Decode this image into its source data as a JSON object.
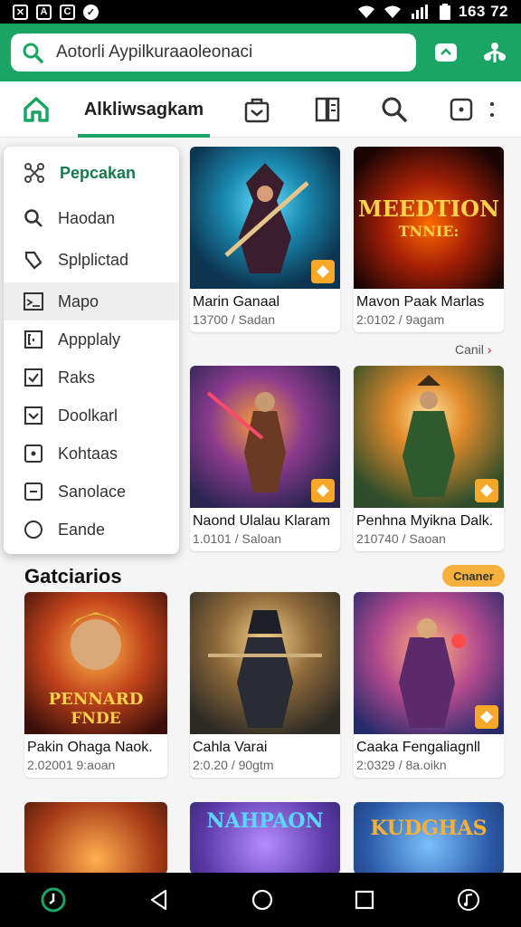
{
  "status_bar": {
    "time": "163 72"
  },
  "search": {
    "text": "Aotorli Aypilkuraaoleonaci"
  },
  "tabs": {
    "active_label": "Alkliwsagkam"
  },
  "side_menu": {
    "header": "Pepcakan",
    "items": [
      {
        "label": "Haodan",
        "icon": "search-icon"
      },
      {
        "label": "Splplictad",
        "icon": "tag-icon"
      },
      {
        "label": "Mapo",
        "icon": "image-icon",
        "active": true
      },
      {
        "label": "Appplaly",
        "icon": "bracket-icon"
      },
      {
        "label": "Raks",
        "icon": "checkbox-icon"
      },
      {
        "label": "Doolkarl",
        "icon": "checkbox-icon"
      },
      {
        "label": "Kohtaas",
        "icon": "dot-square-icon"
      },
      {
        "label": "Sanolace",
        "icon": "dash-square-icon"
      },
      {
        "label": "Eande",
        "icon": "circle-icon"
      }
    ]
  },
  "cards": [
    {
      "title": "Marin Ganaal",
      "meta": "13700 / Sadan"
    },
    {
      "title": "Mavon Paak Marlas",
      "meta": "2:0102 / 9agam",
      "art_line1": "MEEDTION",
      "art_line2": "TNNIE:"
    },
    {
      "title": "Naond Ulalau Klaram",
      "meta": "1.0101 / Saloan"
    },
    {
      "title": "Penhna Myikna Dalk.",
      "meta": "210740 / Saoan"
    },
    {
      "title": "Pakin Ohaga Naok.",
      "meta": "2.02001 9:aoan",
      "art_line1": "PENNARD",
      "art_line2": "FNDE"
    },
    {
      "title": "Cahla Varai",
      "meta": "2:0.20 / 90gtm"
    },
    {
      "title": "Caaka Fengaliagnll",
      "meta": "2:0329 / 8a.oikn"
    },
    {
      "art_line1": "NAHPAON"
    },
    {
      "art_line1": "KUDGHAS"
    }
  ],
  "more_link": "Canil",
  "section": {
    "title": "Gatciarios",
    "pill": "Cnaner"
  },
  "colors": {
    "brand": "#1aa564",
    "badge": "#f7a826",
    "pill": "#f5b13c"
  }
}
